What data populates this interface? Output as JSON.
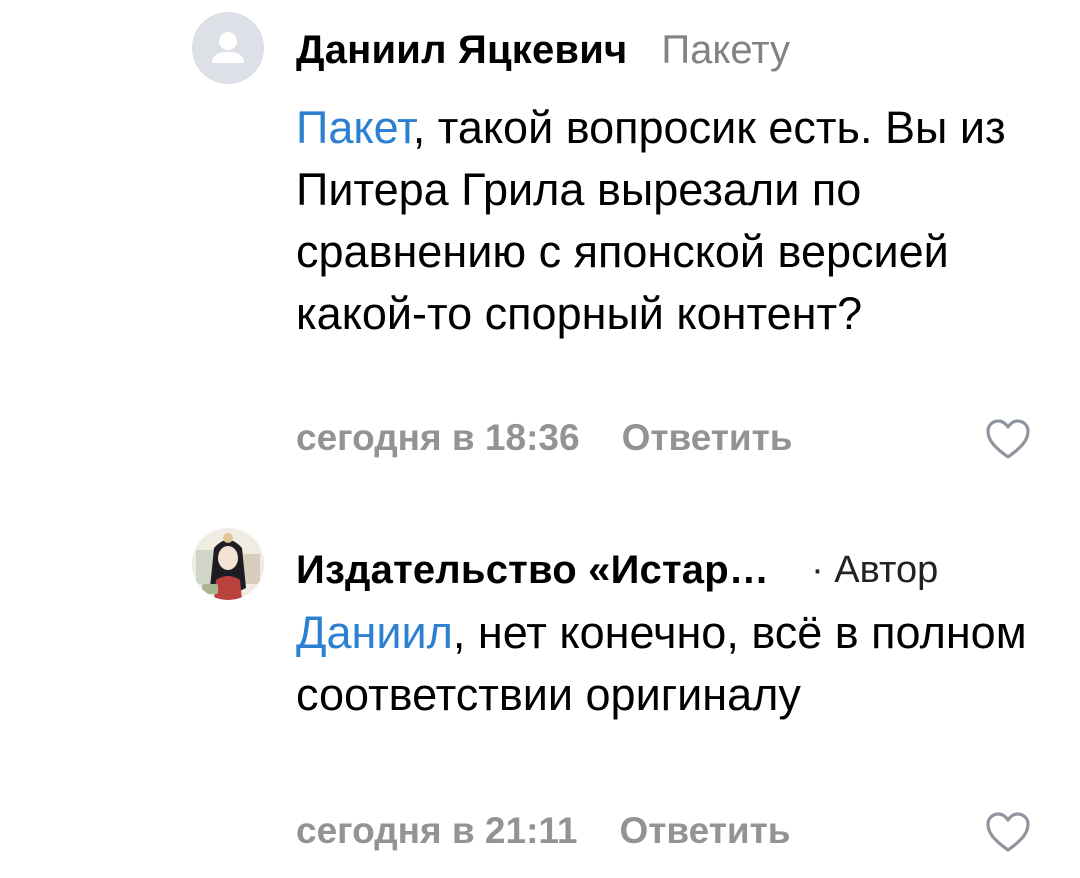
{
  "comments": [
    {
      "author": "Даниил Яцкевич",
      "reply_to": "Пакету",
      "mention": "Пакет",
      "text_after_mention": ", такой вопросик есть. Вы из Питера Грила вырезали по сравнению с японской версией какой-то спорный контент?",
      "timestamp": "сегодня в 18:36",
      "reply_label": "Ответить",
      "avatar_icon": "default-user-icon",
      "like_icon": "heart-outline-icon"
    },
    {
      "author": "Издательство «Истар…",
      "badge": "· Автор",
      "mention": "Даниил",
      "text_after_mention": ", нет конечно, всё в полном соответствии оригиналу",
      "timestamp": "сегодня в 21:11",
      "reply_label": "Ответить",
      "avatar_icon": "anime-girl-avatar-image",
      "like_icon": "heart-outline-icon"
    }
  ],
  "colors": {
    "mention": "#2d80d0",
    "secondary_text": "#939393",
    "reply_target": "#828282",
    "avatar_placeholder": "#dde1e7",
    "avatar_glyph": "#ffffff"
  }
}
